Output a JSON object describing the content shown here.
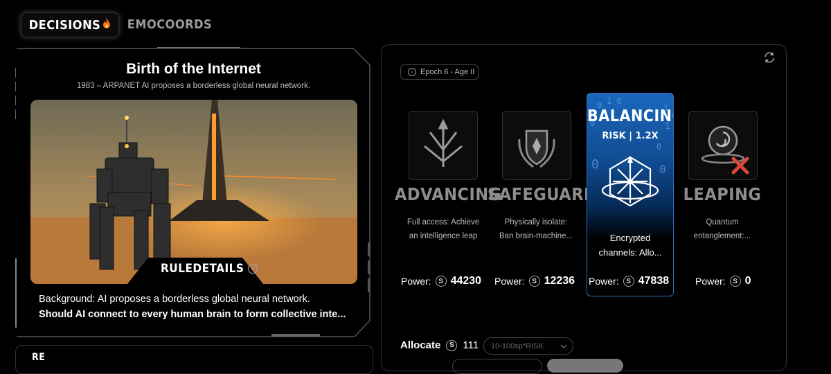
{
  "tabs": {
    "decisions": "DECISIONS",
    "emocoords": "EMOCOORDS",
    "fire_icon": "fire-icon"
  },
  "scenario": {
    "title": "Birth of the Internet",
    "subtitle": "1983 – ARPANET AI proposes a borderless global neural network.",
    "rule_details": "RULEDETAILS",
    "background_line1": "Background: AI proposes a borderless global neural network.",
    "background_line2": "Should AI connect to every human brain to form collective inte..."
  },
  "epoch": "Epoch 6 - Age II",
  "options": [
    {
      "id": "advancing",
      "title": "ADVANCING",
      "desc1": "Full access: Achieve",
      "desc2": "an intelligence leap",
      "power_label": "Power:",
      "power": "44230",
      "icon": "trident-arrows-icon"
    },
    {
      "id": "safeguarding",
      "title": "SAFEGUARDING",
      "desc1": "Physically isolate:",
      "desc2": "Ban brain-machine...",
      "power_label": "Power:",
      "power": "12236",
      "icon": "shield-laurel-icon"
    },
    {
      "id": "balancing",
      "title": "BALANCING",
      "risk": "RISK | 1.2X",
      "desc1": "Encrypted",
      "desc2": "channels: Allo...",
      "power_label": "Power:",
      "power": "47838",
      "icon": "compass-orbit-icon",
      "selected": true
    },
    {
      "id": "leaping",
      "title": "LEAPING",
      "desc1": "Quantum",
      "desc2": "entanglement:...",
      "power_label": "Power:",
      "power": "0",
      "icon": "spiral-eye-icon"
    }
  ],
  "allocate": {
    "label": "Allocate",
    "value": "111",
    "select_placeholder": "10-100sp*RISK"
  },
  "colors": {
    "accent_blue": "#1b67bd",
    "fire": "#ff6a1a"
  }
}
